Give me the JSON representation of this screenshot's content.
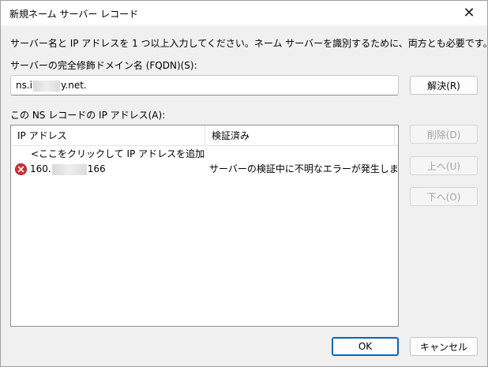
{
  "window": {
    "title": "新規ネーム サーバー レコード",
    "close_glyph": "✕"
  },
  "instruction": "サーバー名と IP アドレスを 1 つ以上入力してください。ネーム サーバーを識別するために、両方とも必要です。",
  "fqdn": {
    "label": "サーバーの完全修飾ドメイン名 (FQDN)(S):",
    "value_prefix": "ns.i",
    "value_suffix": "y.net.",
    "resolve_button": "解決(R)"
  },
  "ip_list": {
    "label": "この NS レコードの IP アドレス(A):",
    "columns": [
      "IP アドレス",
      "検証済み"
    ],
    "rows": [
      {
        "ip": "<ここをクリックして IP アドレスを追加してくださ...",
        "status": "",
        "icon": "none"
      },
      {
        "ip_prefix": "160.",
        "ip_suffix": "166",
        "status": "サーバーの検証中に不明なエラーが発生しました。",
        "icon": "error-icon"
      }
    ]
  },
  "side_buttons": {
    "delete": "削除(D)",
    "up": "上へ(U)",
    "down": "下へ(O)"
  },
  "footer": {
    "ok": "OK",
    "cancel": "キャンセル"
  },
  "colors": {
    "error": "#d13438",
    "accent": "#0067c0",
    "disabled_text": "#a3a3a3"
  }
}
